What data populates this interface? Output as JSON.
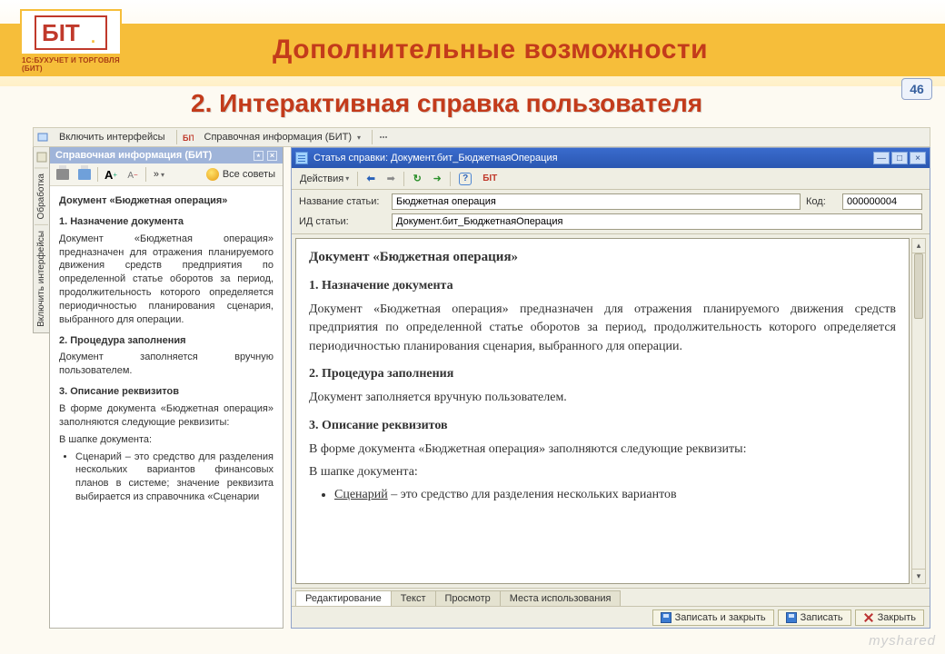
{
  "slide": {
    "title": "Дополнительные возможности",
    "subtitle": "2.  Интерактивная справка пользователя",
    "page_number": "46",
    "logo_sub": "1С:БУХУЧЕТ И ТОРГОВЛЯ (БИТ)",
    "watermark": "myshared"
  },
  "menubar": {
    "include_interfaces": "Включить интерфейсы",
    "help_info": "Справочная информация (БИТ)"
  },
  "help_panel": {
    "title": "Справочная информация (БИТ)",
    "all_tips": "Все советы",
    "vtabs": {
      "t1": "Обработка",
      "t2": "Включить интерфейсы"
    },
    "doc_heading": "Документ «Бюджетная операция»",
    "s1_title": "1.   Назначение документа",
    "s1_body": "Документ «Бюджетная операция» предназначен для отражения планируемого движения средств предприятия по определенной статье оборотов за период, продолжительность которого определяется периодичностью планирования сценария, выбранного для операции.",
    "s2_title": "2.   Процедура заполнения",
    "s2_body": "Документ заполняется вручную пользователем.",
    "s3_title": "3.   Описание реквизитов",
    "s3_body": "В форме документа «Бюджетная операция» заполняются следующие реквизиты:",
    "s3_sub": "В шапке документа:",
    "s3_li1": "Сценарий – это средство для разделения нескольких вариантов финансовых планов в системе; значение реквизита выбирается из справочника «Сценарии"
  },
  "article_win": {
    "title": "Статья справки: Документ.бит_БюджетнаяОперация",
    "toolbar": {
      "actions": "Действия"
    },
    "form": {
      "name_lbl": "Название статьи:",
      "name_val": "Бюджетная операция",
      "code_lbl": "Код:",
      "code_val": "000000004",
      "id_lbl": "ИД статьи:",
      "id_val": "Документ.бит_БюджетнаяОперация"
    },
    "content": {
      "heading": "Документ «Бюджетная операция»",
      "s1_title": "1.   Назначение документа",
      "s1_body": "Документ «Бюджетная операция» предназначен для отражения планируемого движения средств предприятия по определенной статье оборотов за период, продолжительность которого определяется периодичностью планирования сценария, выбранного для операции.",
      "s2_title": "2.   Процедура заполнения",
      "s2_body": "Документ заполняется вручную пользователем.",
      "s3_title": "3.   Описание реквизитов",
      "s3_body": "В форме документа «Бюджетная операция» заполняются следующие реквизиты:",
      "s3_sub": "В шапке документа:",
      "s3_li1_a": "Сценарий",
      "s3_li1_b": " – это средство для разделения нескольких вариантов"
    },
    "tabs": {
      "t1": "Редактирование",
      "t2": "Текст",
      "t3": "Просмотр",
      "t4": "Места использования"
    },
    "footer": {
      "save_close": "Записать и закрыть",
      "save": "Записать",
      "close": "Закрыть"
    }
  }
}
